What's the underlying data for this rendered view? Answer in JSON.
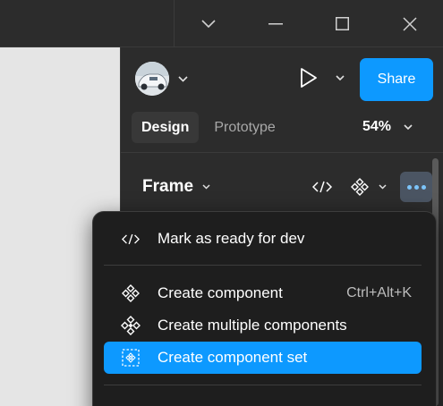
{
  "window": {
    "controls": [
      "chevron-down-icon",
      "minimize-icon",
      "maximize-icon",
      "close-icon"
    ]
  },
  "toolbar": {
    "share_label": "Share"
  },
  "tabs": [
    {
      "label": "Design",
      "active": true
    },
    {
      "label": "Prototype",
      "active": false
    }
  ],
  "zoom": {
    "value": "54%"
  },
  "frame": {
    "label": "Frame"
  },
  "context_menu": {
    "items": [
      {
        "label": "Mark as ready for dev",
        "shortcut": "",
        "icon": "code-icon"
      },
      {
        "label": "Create component",
        "shortcut": "Ctrl+Alt+K",
        "icon": "component-icon"
      },
      {
        "label": "Create multiple components",
        "shortcut": "",
        "icon": "multiple-components-icon"
      },
      {
        "label": "Create component set",
        "shortcut": "",
        "icon": "component-set-icon",
        "highlighted": true
      }
    ]
  },
  "colors": {
    "accent": "#0d99ff",
    "panel_bg": "#2c2c2c",
    "menu_bg": "#1e1e1e",
    "canvas_bg": "#e5e5e5"
  }
}
